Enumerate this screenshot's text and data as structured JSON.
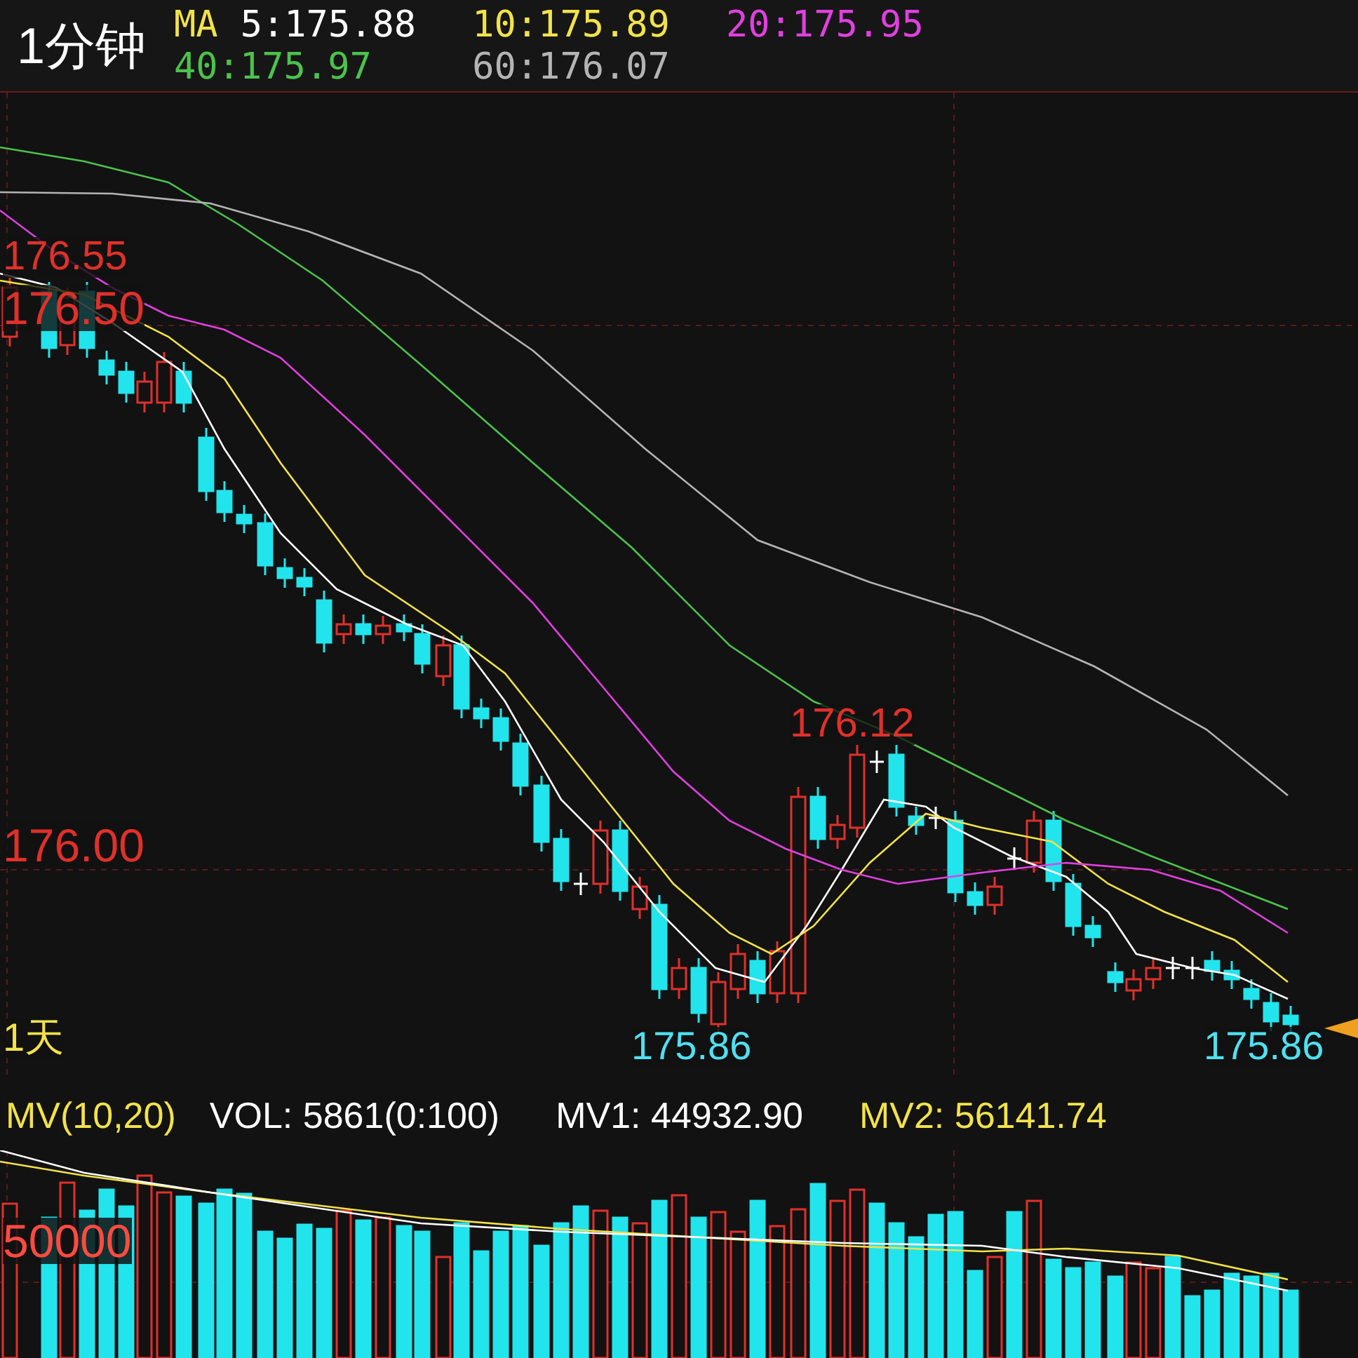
{
  "header": {
    "period": "1分钟",
    "ma_label": "MA",
    "ma_values": [
      {
        "text": "5:175.88",
        "color": "#ffffff"
      },
      {
        "text": "10:175.89",
        "color": "#f2e24a"
      },
      {
        "text": "20:175.95",
        "color": "#e040e0"
      },
      {
        "text": "40:175.97",
        "color": "#4cc24c"
      },
      {
        "text": "60:176.07",
        "color": "#b4b4b4"
      }
    ]
  },
  "price_chart": {
    "labels": [
      {
        "text": "176.55",
        "kind": "high"
      },
      {
        "text": "176.50",
        "kind": "level"
      },
      {
        "text": "176.12",
        "kind": "high"
      },
      {
        "text": "176.00",
        "kind": "level"
      },
      {
        "text": "1天",
        "kind": "period"
      },
      {
        "text": "175.86",
        "kind": "low"
      },
      {
        "text": "175.86",
        "kind": "low"
      }
    ]
  },
  "volume_panel": {
    "indicator": "MV(10,20)",
    "vol": "VOL: 5861(0:100)",
    "mv1": "MV1: 44932.90",
    "mv2": "MV2: 56141.74",
    "axis_label": "50000"
  }
}
